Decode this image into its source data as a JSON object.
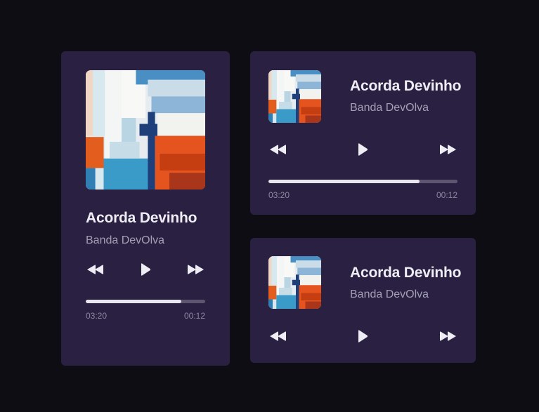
{
  "player": {
    "song_title": "Acorda Devinho",
    "artist": "Banda DevOlva",
    "time_elapsed": "03:20",
    "time_remaining": "00:12",
    "progress_fraction": 0.8,
    "controls": {
      "previous_icon": "rewind-icon",
      "play_icon": "play-icon",
      "next_icon": "fast-forward-icon"
    }
  },
  "colors": {
    "background": "#0f0d14",
    "card": "#2a2142",
    "title": "#efedf4",
    "artist": "#a59fb6",
    "progress_track": "#5e5670",
    "progress_fill": "#e9e6ef"
  }
}
